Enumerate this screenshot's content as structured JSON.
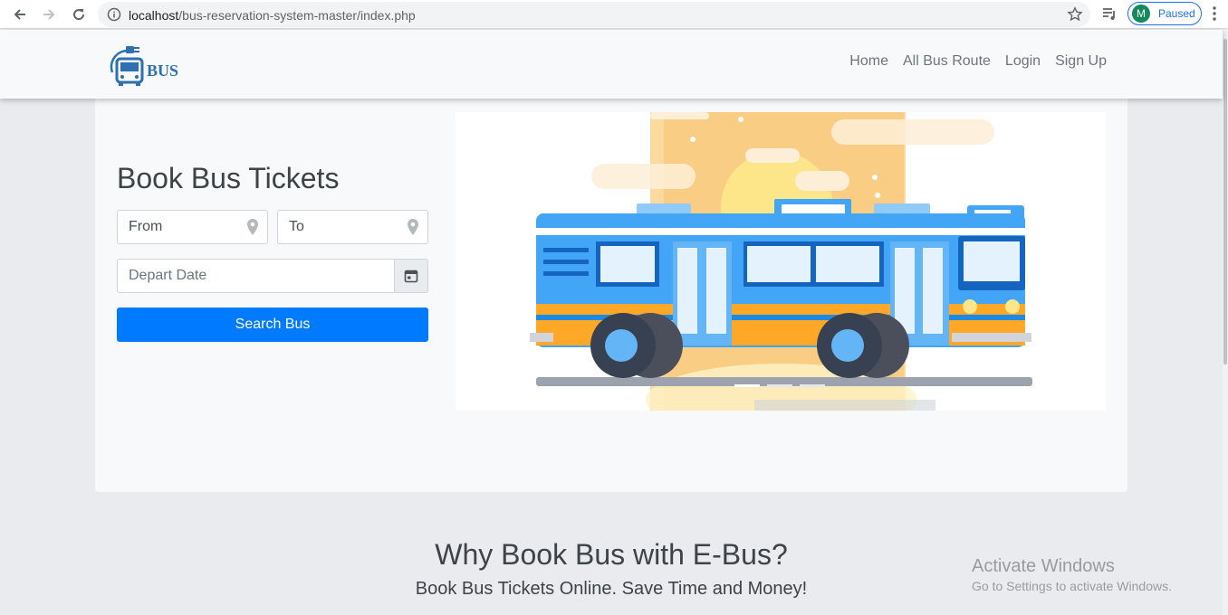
{
  "browser": {
    "url_host": "localhost",
    "url_path": "/bus-reservation-system-master/index.php",
    "profile_initial": "M",
    "profile_status": "Paused"
  },
  "site": {
    "logo_text": "BUS",
    "nav": [
      "Home",
      "All Bus Route",
      "Login",
      "Sign Up"
    ]
  },
  "hero": {
    "title": "Book Bus Tickets",
    "from_placeholder": "From",
    "to_placeholder": "To",
    "date_placeholder": "Depart Date",
    "search_label": "Search Bus"
  },
  "why": {
    "title": "Why Book Bus with E-Bus?",
    "subtitle": "Book Bus Tickets Online. Save Time and Money!"
  },
  "watermark": {
    "line1": "Activate Windows",
    "line2": "Go to Settings to activate Windows."
  }
}
